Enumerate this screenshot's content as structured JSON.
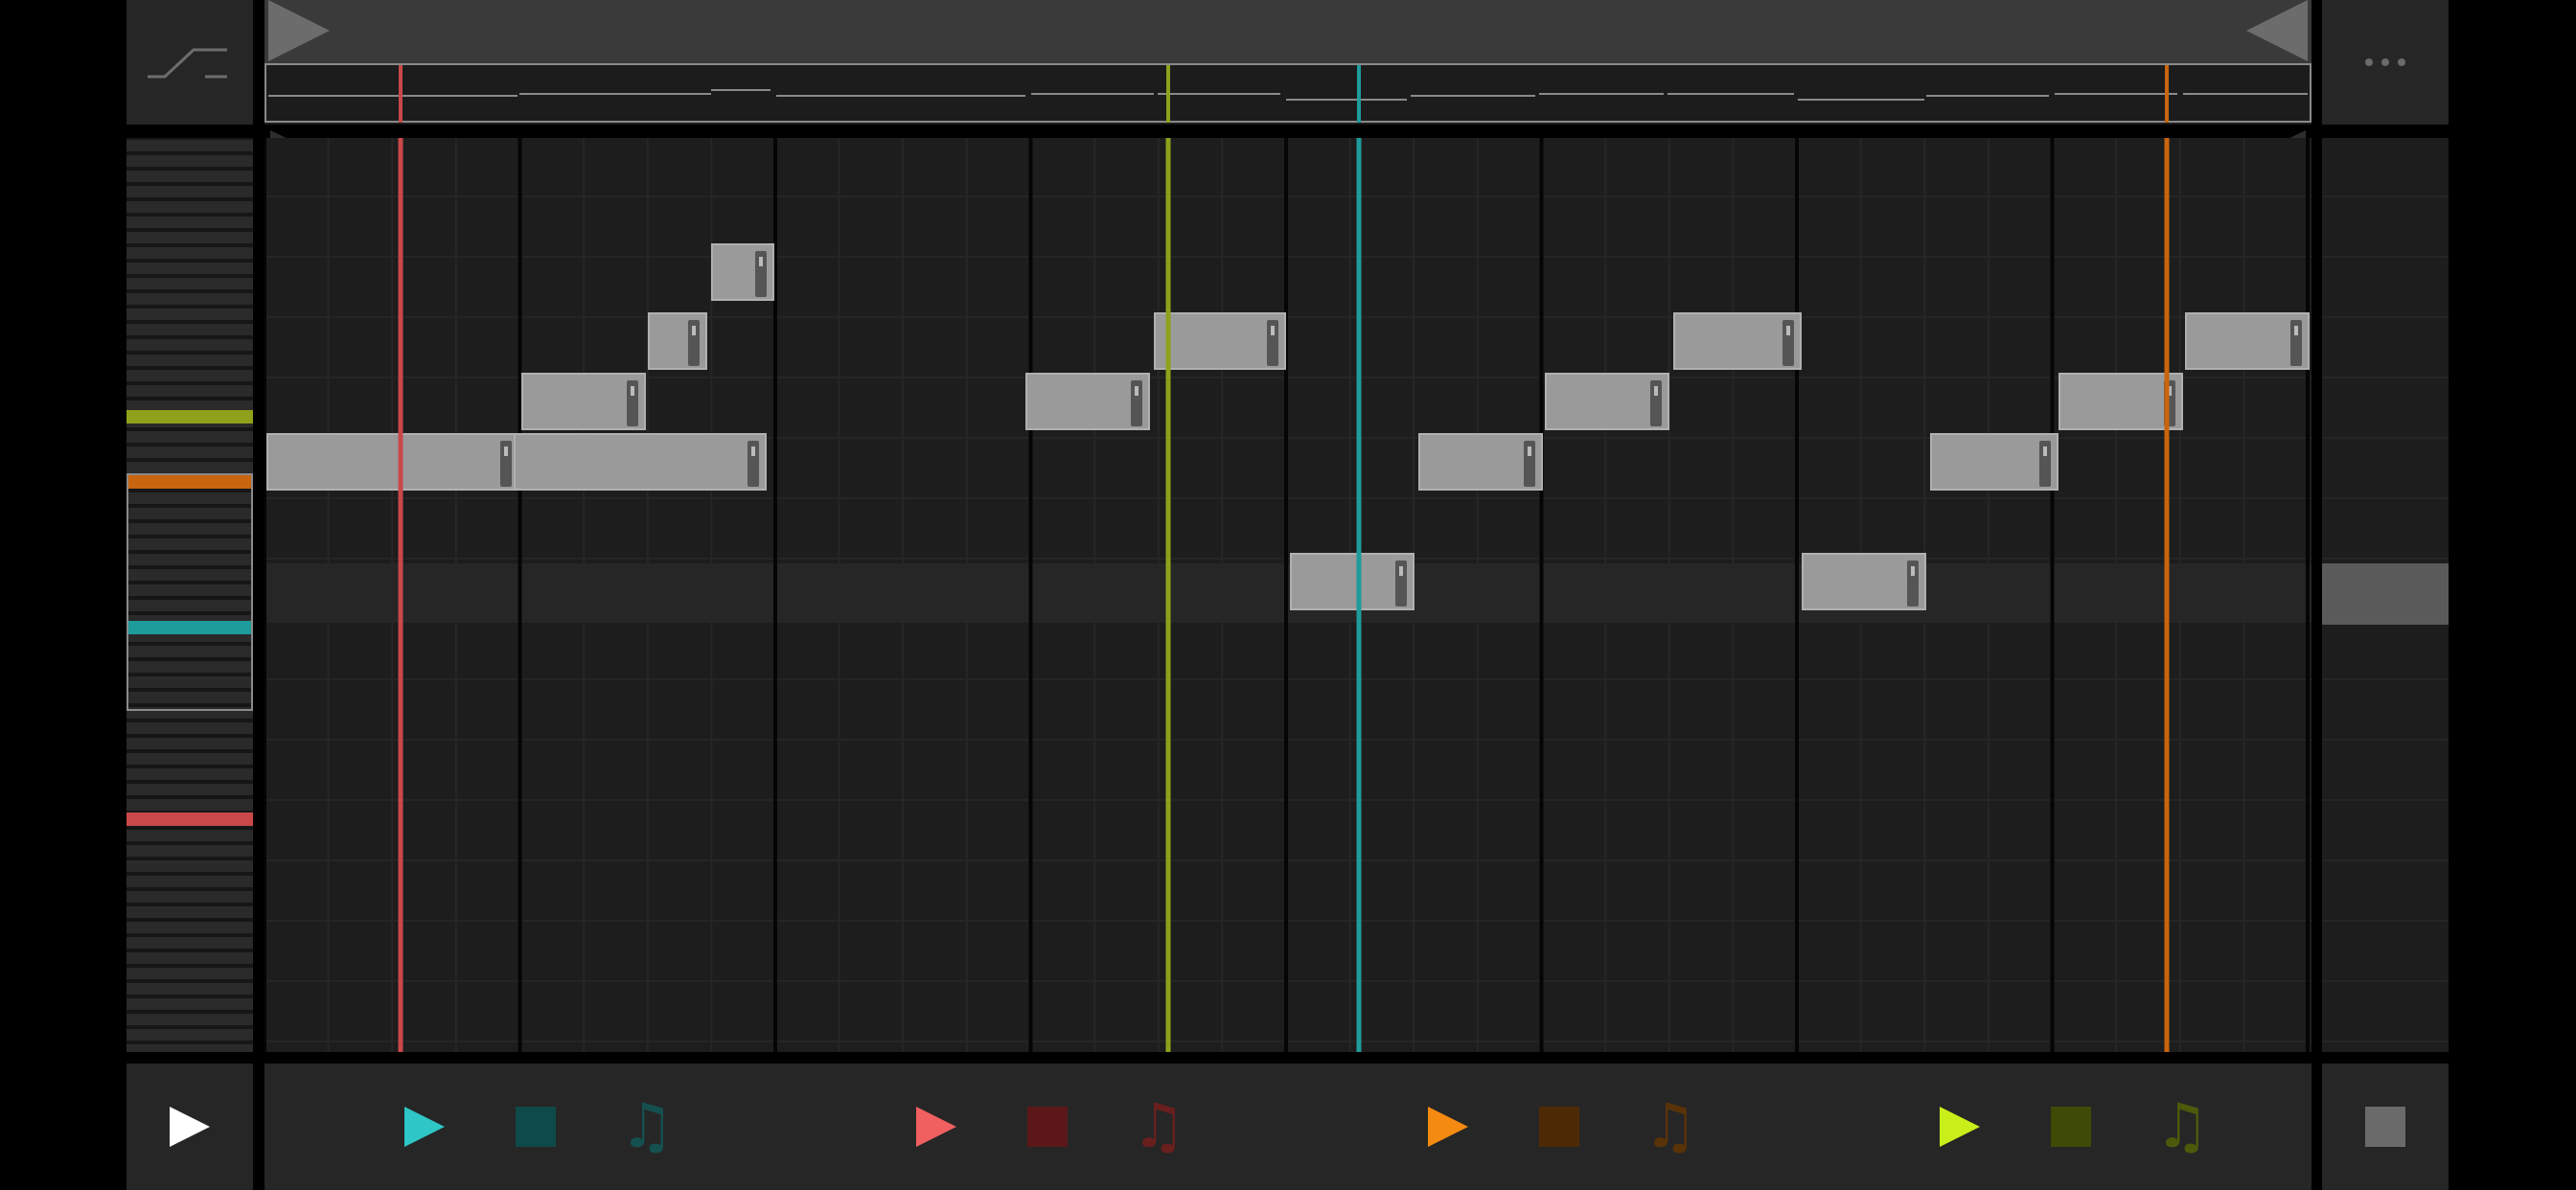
{
  "colors": {
    "track1": "#c94849",
    "track2": "#8fa11b",
    "track3": "#1e9c9c",
    "track4": "#c8650e",
    "note": "#9a9a9a"
  },
  "icons": {
    "curve": "automation-curve-icon",
    "more": "more-dots-icon",
    "play": "play-icon",
    "stop": "stop-icon",
    "note": "music-note-icon"
  },
  "transport": {
    "groups": [
      {
        "play_color": "#2fc6c6",
        "stop_color": "#0f4a4a",
        "note_color": "#155050"
      },
      {
        "play_color": "#f06060",
        "stop_color": "#5c1818",
        "note_color": "#6a1f1f"
      },
      {
        "play_color": "#f58a12",
        "stop_color": "#4d2a05",
        "note_color": "#5a3208"
      },
      {
        "play_color": "#c8ef1a",
        "stop_color": "#3e4a06",
        "note_color": "#4c5a0b"
      }
    ],
    "note_glyph": "♫"
  }
}
